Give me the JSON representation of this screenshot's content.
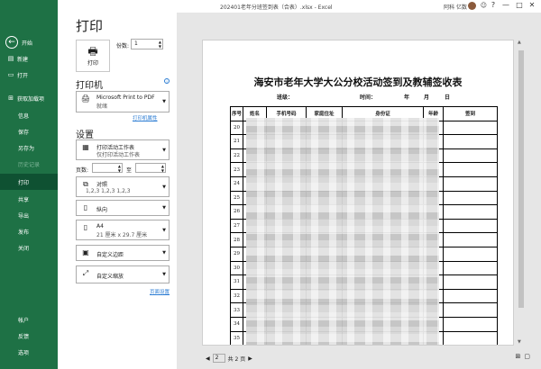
{
  "window": {
    "doc_title": "202401老年分班签到表（合表）.xlsx  -  Excel",
    "user_name": "阿科 亿数",
    "emoji": "☺",
    "buttons": [
      "?",
      "—",
      "□",
      "✕"
    ]
  },
  "sidebar": {
    "back": "←",
    "items": [
      {
        "label": "开始",
        "icon": "⌂"
      },
      {
        "label": "新建",
        "icon": "▤"
      },
      {
        "label": "打开",
        "icon": "▭"
      },
      {
        "label": "获取加载项",
        "icon": "⊞"
      },
      {
        "label": "信息"
      },
      {
        "label": "保存"
      },
      {
        "label": "另存为"
      },
      {
        "label": "历史记录"
      },
      {
        "label": "打印"
      },
      {
        "label": "共享"
      },
      {
        "label": "导出"
      },
      {
        "label": "发布"
      },
      {
        "label": "关闭"
      },
      {
        "label": "帐户"
      },
      {
        "label": "反馈"
      },
      {
        "label": "选项"
      }
    ]
  },
  "print_panel": {
    "title": "打印",
    "print_button": "打印",
    "copies_label": "份数:",
    "copies_value": "1",
    "printer_heading": "打印机",
    "printer_name": "Microsoft Print to PDF",
    "printer_status": "就绪",
    "printer_props": "打印机属性",
    "settings_heading": "设置",
    "scope_line1": "打印活动工作表",
    "scope_line2": "仅打印活动工作表",
    "pages_label": "页数:",
    "to_label": "至",
    "collate_line1": "对照",
    "collate_line2": "1,2,3    1,2,3    1,2,3",
    "orientation": "纵向",
    "paper_line1": "A4",
    "paper_line2": "21 厘米 x 29.7 厘米",
    "margins": "自定义边距",
    "scaling": "自定义缩放",
    "page_setup": "页面设置"
  },
  "preview": {
    "sheet_title": "海安市老年大学大公分校活动签到及教辅签收表",
    "class_label": "班级：",
    "time_label": "时间：",
    "year_label": "年",
    "month_label": "月",
    "day_label": "日",
    "headers": [
      "序号",
      "姓名",
      "手机号码",
      "家庭住址",
      "身份证",
      "年龄",
      "签到"
    ],
    "row_numbers": [
      "20",
      "21",
      "22",
      "23",
      "24",
      "25",
      "26",
      "27",
      "28",
      "29",
      "30",
      "31",
      "32",
      "33",
      "34",
      "35",
      "36"
    ]
  },
  "pager": {
    "prev": "◀",
    "current": "2",
    "total": "共 2 页",
    "next": "▶"
  }
}
